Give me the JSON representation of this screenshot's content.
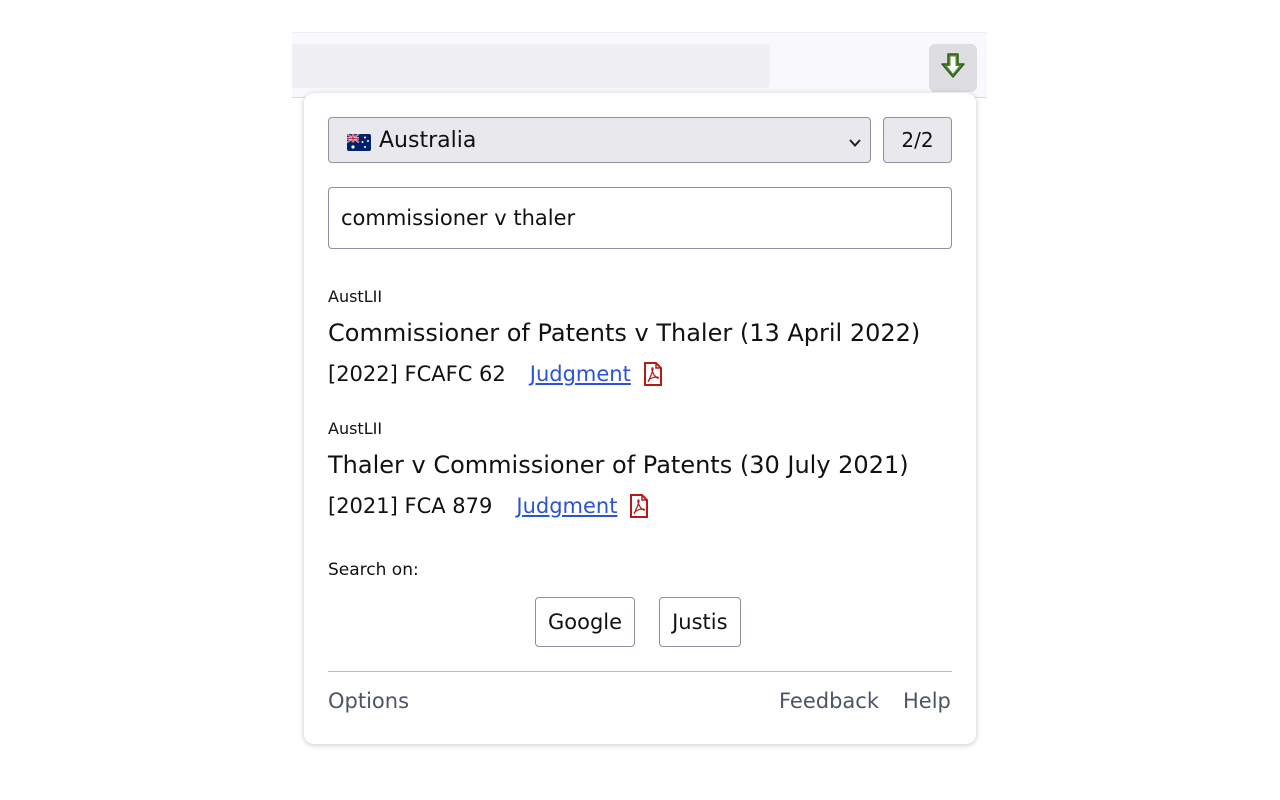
{
  "toolbar": {
    "extension_icon": "download-arrow-icon",
    "accent_color": "#4e8a2f"
  },
  "popup": {
    "country_select": {
      "value": "Australia",
      "flag": "australia-flag-icon"
    },
    "page_counter": "2/2",
    "search": {
      "value": "commissioner v thaler"
    },
    "results": [
      {
        "source": "AustLII",
        "title": "Commissioner of Patents v Thaler (13 April 2022)",
        "citation": "[2022] FCAFC 62",
        "link_label": "Judgment",
        "pdf_icon": "pdf-icon"
      },
      {
        "source": "AustLII",
        "title": "Thaler v Commissioner of Patents (30 July 2021)",
        "citation": "[2021] FCA 879",
        "link_label": "Judgment",
        "pdf_icon": "pdf-icon"
      }
    ],
    "search_on": {
      "label": "Search on:",
      "engines": [
        "Google",
        "Justis"
      ]
    },
    "footer": {
      "options": "Options",
      "feedback": "Feedback",
      "help": "Help"
    }
  },
  "colors": {
    "link": "#2b53d6",
    "pdf_red": "#b31b1b",
    "footer_text": "#4c5566"
  }
}
